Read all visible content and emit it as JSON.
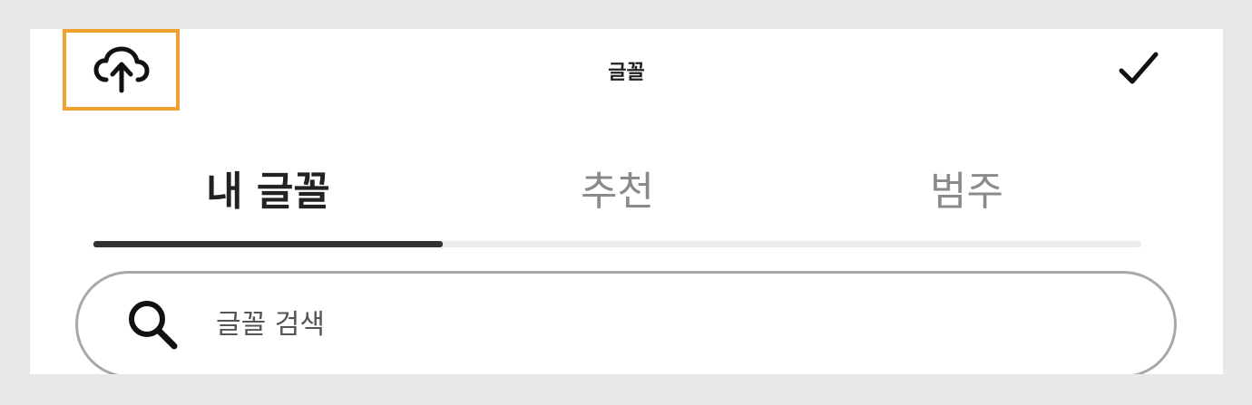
{
  "header": {
    "title": "글꼴",
    "upload_icon": "cloud-upload-icon",
    "confirm_icon": "checkmark-icon",
    "highlight_color": "#f0a030"
  },
  "tabs": {
    "items": [
      {
        "label": "내 글꼴",
        "active": true
      },
      {
        "label": "추천",
        "active": false
      },
      {
        "label": "범주",
        "active": false
      }
    ],
    "selected_index": 0,
    "indicator_fraction": 0.333
  },
  "search": {
    "placeholder": "글꼴 검색",
    "value": "",
    "icon": "search-icon"
  }
}
